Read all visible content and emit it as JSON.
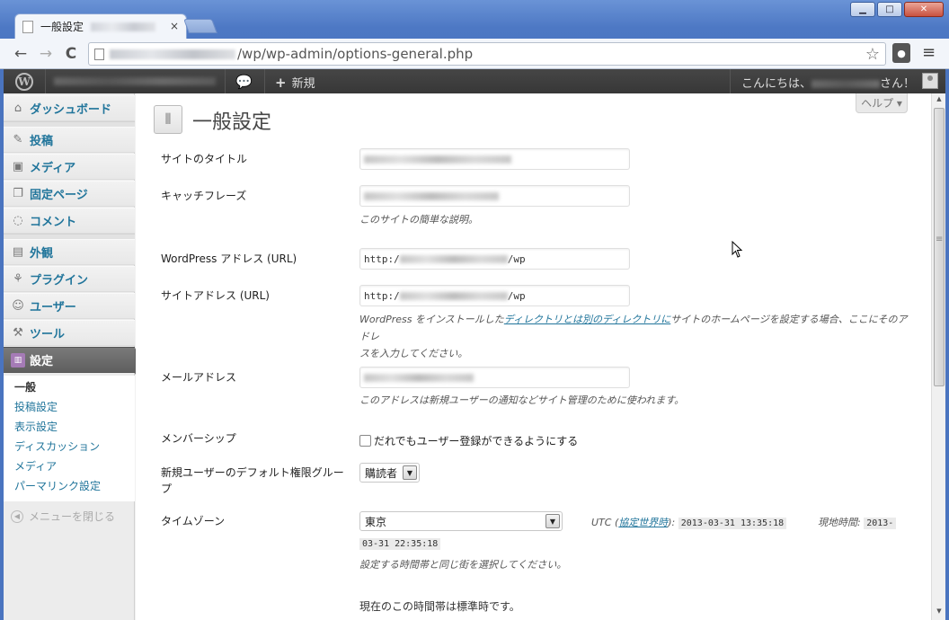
{
  "browser": {
    "tab_title": "一般設定",
    "tab_close": "×",
    "url_path": "/wp/wp-admin/options-general.php",
    "window_buttons": {
      "minimize": "▁",
      "maximize": "□",
      "close": "✕"
    },
    "nav": {
      "back": "←",
      "forward": "→",
      "reload": "C"
    },
    "star": "☆",
    "menu": "≡"
  },
  "adminbar": {
    "new_label": "新規",
    "new_plus": "+",
    "howdy_prefix": "こんにちは、",
    "howdy_suffix": "さん！"
  },
  "sidebar": {
    "items": [
      {
        "label": "ダッシュボード",
        "icon": "home-icon"
      },
      {
        "label": "投稿",
        "icon": "pin-icon"
      },
      {
        "label": "メディア",
        "icon": "media-icon"
      },
      {
        "label": "固定ページ",
        "icon": "pages-icon"
      },
      {
        "label": "コメント",
        "icon": "comment-icon"
      },
      {
        "label": "外観",
        "icon": "appearance-icon"
      },
      {
        "label": "プラグイン",
        "icon": "plugin-icon"
      },
      {
        "label": "ユーザー",
        "icon": "users-icon"
      },
      {
        "label": "ツール",
        "icon": "tools-icon"
      },
      {
        "label": "設定",
        "icon": "settings-icon"
      }
    ],
    "submenu": [
      "一般",
      "投稿設定",
      "表示設定",
      "ディスカッション",
      "メディア",
      "パーマリンク設定"
    ],
    "collapse": "メニューを閉じる"
  },
  "main": {
    "help": "ヘルプ",
    "title": "一般設定",
    "fields": {
      "site_title": "サイトのタイトル",
      "tagline": "キャッチフレーズ",
      "tagline_desc": "このサイトの簡単な説明。",
      "wp_address": "WordPress アドレス (URL)",
      "wp_address_prefix": "http:/",
      "wp_address_suffix": "/wp",
      "site_address": "サイトアドレス (URL)",
      "site_address_prefix": "http:/",
      "site_address_suffix": "/wp",
      "site_address_desc_1": "WordPress をインストールした",
      "site_address_desc_link": "ディレクトリとは別のディレクトリに",
      "site_address_desc_2": "サイトのホームページを設定する場合、ここにそのアドレ",
      "site_address_desc_3": "スを入力してください。",
      "email": "メールアドレス",
      "email_desc": "このアドレスは新規ユーザーの通知などサイト管理のために使われます。",
      "membership": "メンバーシップ",
      "membership_checkbox": "だれでもユーザー登録ができるようにする",
      "default_role_1": "新規ユーザーのデフォルト権限グルー",
      "default_role_2": "プ",
      "default_role_value": "購読者",
      "timezone": "タイムゾーン",
      "timezone_value": "東京",
      "utc_prefix": "UTC (",
      "utc_link": "協定世界時",
      "utc_suffix": "):",
      "utc_time": "2013-03-31 13:35:18",
      "local_label": "現地時間:",
      "local_time_1": "2013-",
      "local_time_2": "03-31 22:35:18",
      "timezone_desc": "設定する時間帯と同じ街を選択してください。",
      "standard_time": "現在のこの時間帯は標準時です。"
    }
  }
}
